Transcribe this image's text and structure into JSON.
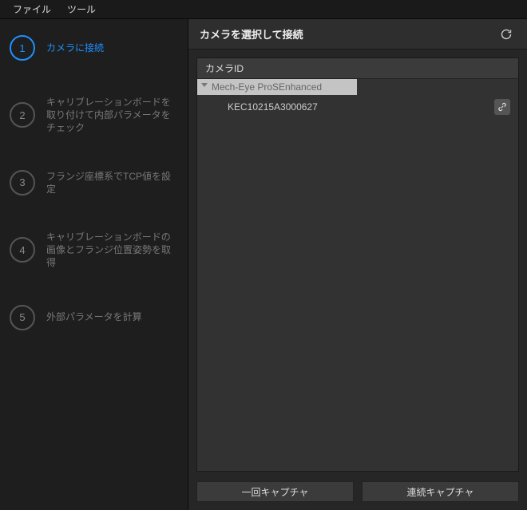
{
  "menubar": {
    "file": "ファイル",
    "tool": "ツール"
  },
  "sidebar": {
    "steps": [
      {
        "num": "1",
        "label": "カメラに接続"
      },
      {
        "num": "2",
        "label": "キャリブレーションボードを取り付けて内部パラメータをチェック"
      },
      {
        "num": "3",
        "label": "フランジ座標系でTCP値を設定"
      },
      {
        "num": "4",
        "label": "キャリブレーションボードの画像とフランジ位置姿勢を取得"
      },
      {
        "num": "5",
        "label": "外部パラメータを計算"
      }
    ]
  },
  "content": {
    "title": "カメラを選択して接続",
    "column_header": "カメラID",
    "group_label": "Mech-Eye ProSEnhanced",
    "items": [
      {
        "id": "KEC10215A3000627"
      }
    ]
  },
  "footer": {
    "capture_once": "一回キャプチャ",
    "capture_cont": "連続キャプチャ"
  }
}
